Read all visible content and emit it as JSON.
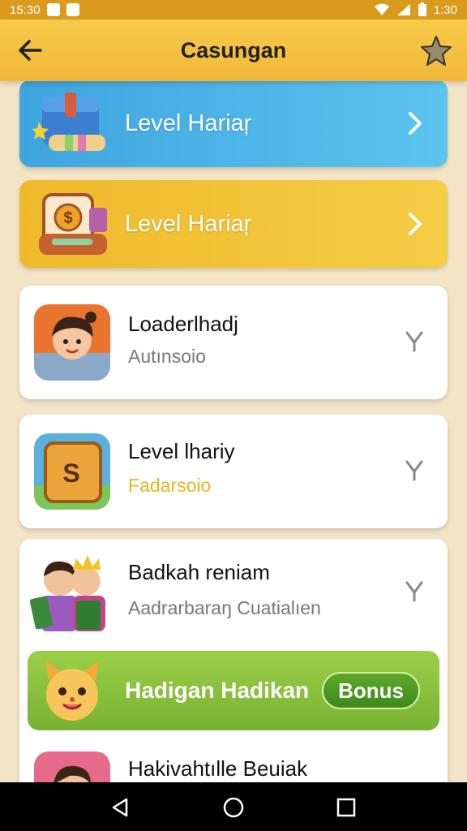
{
  "status_bar": {
    "time_left": "15:30",
    "time_right": "1:30"
  },
  "app_bar": {
    "title": "Casungan",
    "back_icon": "arrow-left-icon",
    "fav_icon": "star-icon"
  },
  "banners": [
    {
      "label": "Level Hariaŗ",
      "color": "#4fb3e6"
    },
    {
      "label": "Level Hariaŗ",
      "color": "#f0c23a"
    }
  ],
  "cards": [
    {
      "title": "Loaderlhadj",
      "subtitle": "Autınsoio",
      "subtitle_color": "#777777"
    },
    {
      "title": "Level lhariy",
      "subtitle": "Fadarsoio",
      "subtitle_color": "#e8b520"
    },
    {
      "title": "Badkah reniam",
      "subtitle": "Aadrarbaraŋ Cuatialıen",
      "subtitle_color": "#777777"
    }
  ],
  "bonus": {
    "label": "Hadigan Hadikan",
    "button": "Bonus"
  },
  "partial_card": {
    "title": "Hakivahtılle Beuiak"
  },
  "colors": {
    "accent": "#f2b83a",
    "green": "#78b233",
    "blue": "#4fb3e6"
  }
}
